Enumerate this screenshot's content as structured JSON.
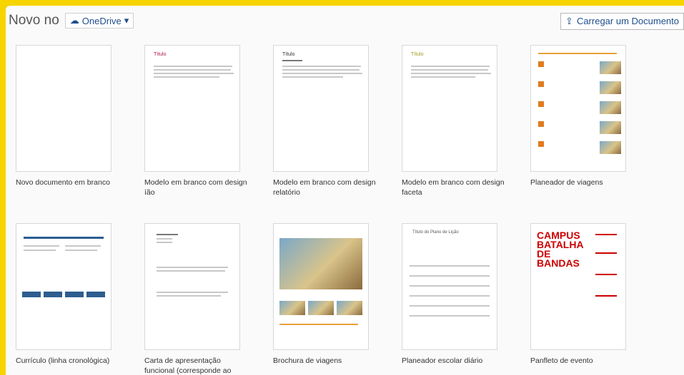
{
  "header": {
    "title": "Novo no",
    "location": "OneDrive",
    "upload": "Carregar um Documento"
  },
  "templates": [
    {
      "label": "Novo documento em branco"
    },
    {
      "label": "Modelo em branco com design íão",
      "title": "Título"
    },
    {
      "label": "Modelo em branco com design relatório",
      "title": "Título"
    },
    {
      "label": "Modelo em branco com design faceta",
      "title": "Título"
    },
    {
      "label": "Planeador de viagens"
    },
    {
      "label": "Currículo (linha cronológica)"
    },
    {
      "label": "Carta de apresentação funcional (corresponde ao modelo funcional)"
    },
    {
      "label": "Brochura de viagens"
    },
    {
      "label": "Planeador escolar diário",
      "title": "Título do Plano de Lição"
    },
    {
      "label": "Panfleto de evento",
      "poster": "CAMPUS BATALHA DE BANDAS"
    }
  ]
}
